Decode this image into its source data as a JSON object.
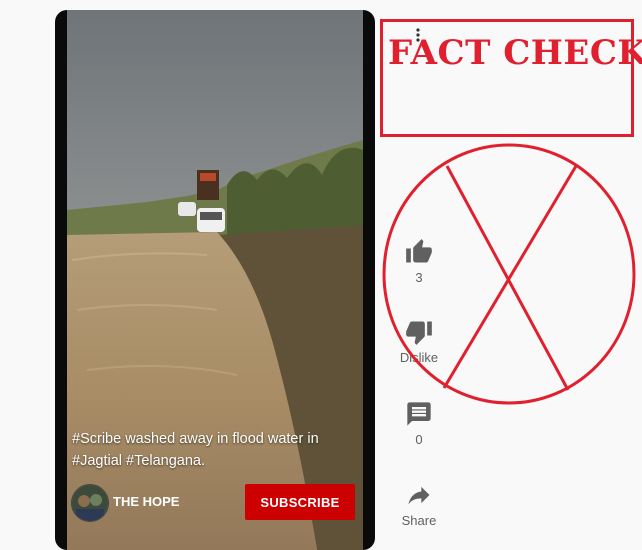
{
  "video": {
    "caption": "#Scribe washed away in flood water in #Jagtial #Telangana.",
    "channel_name": "THE HOPE",
    "subscribe_label": "SUBSCRIBE"
  },
  "actions": {
    "like_count": "3",
    "dislike_label": "Dislike",
    "comment_count": "0",
    "share_label": "Share"
  },
  "overlay": {
    "fact_check_text": "FACT CHECK",
    "color": "#e0202e"
  },
  "colors": {
    "subscribe_bg": "#cc0000",
    "page_bg": "#f9f9f9",
    "icon_gray": "#606060"
  },
  "icons": [
    "thumb-up-icon",
    "thumb-down-icon",
    "comment-icon",
    "share-icon",
    "more-vert-icon"
  ]
}
